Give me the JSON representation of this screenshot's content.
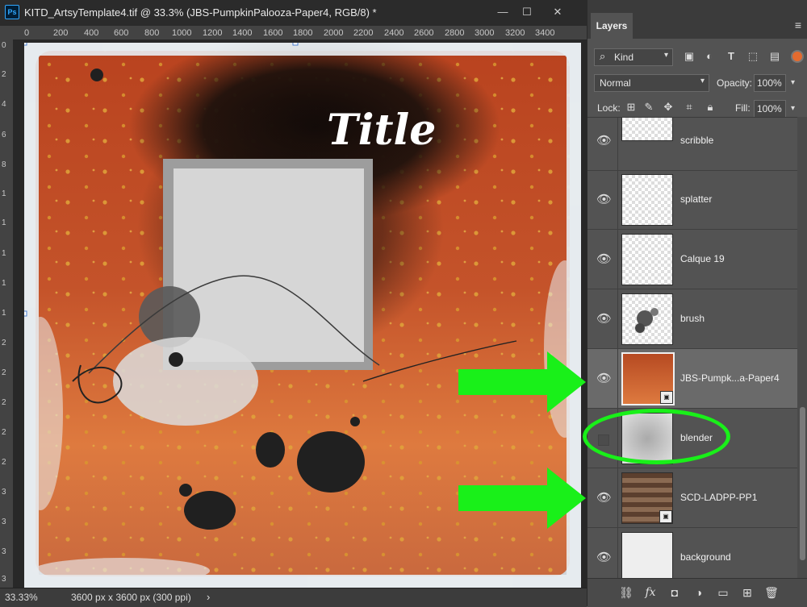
{
  "doc": {
    "app_icon": "Ps",
    "title": "KITD_ArtsyTemplate4.tif @ 33.3% (JBS-PumpkinPalooza-Paper4, RGB/8) *",
    "ruler_h": [
      "0",
      "200",
      "400",
      "600",
      "800",
      "1000",
      "1200",
      "1400",
      "1600",
      "1800",
      "2000",
      "2200",
      "2400",
      "2600",
      "2800",
      "3000",
      "3200",
      "3400"
    ],
    "ruler_v": [
      "0",
      "2",
      "4",
      "6",
      "8",
      "1",
      "1",
      "1",
      "1",
      "1",
      "2",
      "2",
      "2",
      "2",
      "2",
      "3",
      "3",
      "3",
      "3"
    ],
    "canvas_title_text": "Title",
    "status": {
      "zoom": "33.33%",
      "size": "3600 px x 3600 px (300 ppi)",
      "arrow": "›"
    },
    "window_buttons": {
      "minimize": "—",
      "maximize": "☐",
      "close": "✕"
    }
  },
  "panel": {
    "tab_label": "Layers",
    "menu_icon": "≡",
    "filter": {
      "label": "Kind",
      "search_icon": "⌕"
    },
    "filter_icons": [
      "image-filter-icon",
      "adjustment-filter-icon",
      "type-filter-icon",
      "shape-filter-icon",
      "smart-object-filter-icon"
    ],
    "blend_mode": "Normal",
    "opacity_label": "Opacity:",
    "opacity_value": "100%",
    "lock_label": "Lock:",
    "fill_label": "Fill:",
    "fill_value": "100%",
    "layers": [
      {
        "name": "scribble",
        "visible": true,
        "selected": false
      },
      {
        "name": "splatter",
        "visible": true,
        "selected": false
      },
      {
        "name": "Calque 19",
        "visible": true,
        "selected": false
      },
      {
        "name": "brush",
        "visible": true,
        "selected": false
      },
      {
        "name": "JBS-Pumpk...a-Paper4",
        "visible": true,
        "selected": true
      },
      {
        "name": "blender",
        "visible": false,
        "selected": false
      },
      {
        "name": "SCD-LADPP-PP1",
        "visible": true,
        "selected": false
      },
      {
        "name": "background",
        "visible": true,
        "selected": false
      }
    ],
    "footer_icons": [
      "link-layers-icon",
      "fx-icon",
      "layer-mask-icon",
      "adjustment-layer-icon",
      "group-folder-icon",
      "new-layer-icon",
      "delete-layer-icon"
    ]
  },
  "colors": {
    "accent_green": "#19f019",
    "paper_orange": "#c8582a",
    "selected_row": "#6a6a6a"
  }
}
